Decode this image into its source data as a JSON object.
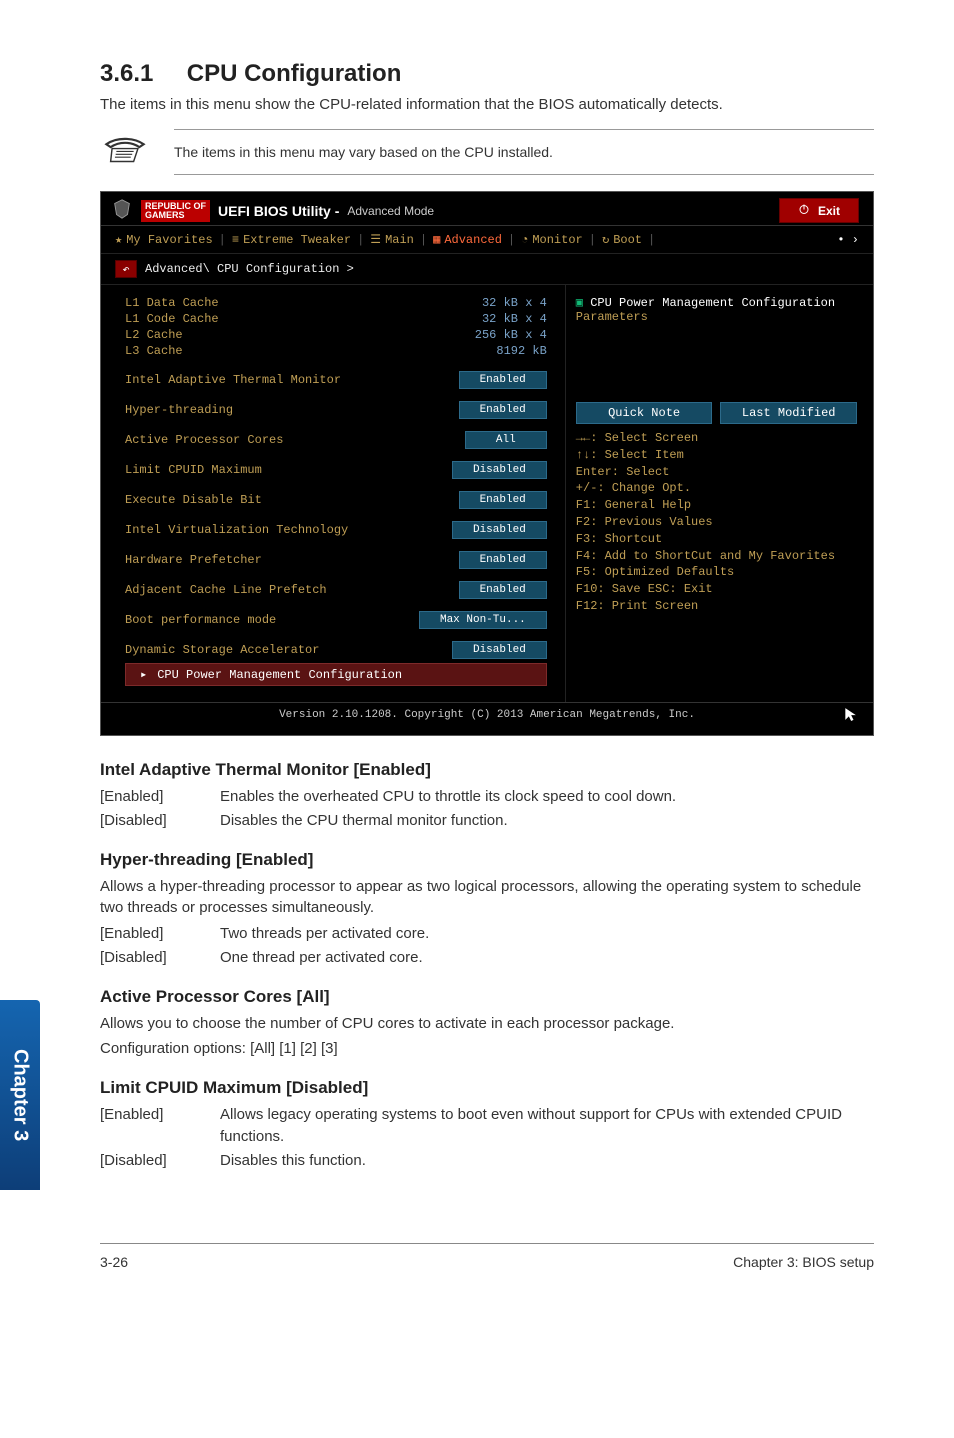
{
  "section": {
    "number": "3.6.1",
    "title": "CPU Configuration",
    "desc": "The items in this menu show the CPU-related information that the BIOS automatically detects.",
    "note": "The items in this menu may vary based on the CPU installed."
  },
  "bios": {
    "brand_top": "REPUBLIC OF",
    "brand_bottom": "GAMERS",
    "title_strong": "UEFI BIOS Utility -",
    "title_light": "Advanced Mode",
    "exit": "Exit",
    "tabs": {
      "fav": "My Favorites",
      "tweak": "Extreme Tweaker",
      "main": "Main",
      "adv": "Advanced",
      "monitor": "Monitor",
      "boot": "Boot"
    },
    "crumb": "Advanced\\ CPU Configuration >",
    "info": [
      {
        "k": "L1 Data Cache",
        "v": "32 kB x 4"
      },
      {
        "k": "L1 Code Cache",
        "v": "32 kB x 4"
      },
      {
        "k": "L2 Cache",
        "v": "256 kB x 4"
      },
      {
        "k": "L3 Cache",
        "v": "8192 kB"
      }
    ],
    "options": [
      {
        "label": "Intel Adaptive Thermal Monitor",
        "value": "Enabled"
      },
      {
        "label": "Hyper-threading",
        "value": "Enabled"
      },
      {
        "label": "Active Processor Cores",
        "value": "All"
      },
      {
        "label": "Limit CPUID Maximum",
        "value": "Disabled"
      },
      {
        "label": "Execute Disable Bit",
        "value": "Enabled"
      },
      {
        "label": "Intel Virtualization Technology",
        "value": "Disabled"
      },
      {
        "label": "Hardware Prefetcher",
        "value": "Enabled"
      },
      {
        "label": "Adjacent Cache Line Prefetch",
        "value": "Enabled"
      },
      {
        "label": "Boot performance mode",
        "value": "Max Non-Tu..."
      },
      {
        "label": "Dynamic Storage Accelerator",
        "value": "Disabled"
      }
    ],
    "selected_row": "CPU Power Management Configuration",
    "right_header": "CPU Power Management Configuration",
    "right_sub": "Parameters",
    "quick_note": "Quick Note",
    "last_modified": "Last Modified",
    "hints": [
      "→←: Select Screen",
      "↑↓: Select Item",
      "Enter: Select",
      "+/-: Change Opt.",
      "F1: General Help",
      "F2: Previous Values",
      "F3: Shortcut",
      "F4: Add to ShortCut and My Favorites",
      "F5: Optimized Defaults",
      "F10: Save  ESC: Exit",
      "F12: Print Screen"
    ],
    "footer": "Version 2.10.1208. Copyright (C) 2013 American Megatrends, Inc."
  },
  "settings": [
    {
      "head": "Intel Adaptive Thermal Monitor [Enabled]",
      "rows": [
        {
          "k": "[Enabled]",
          "d": "Enables the overheated CPU to throttle its clock speed to cool down."
        },
        {
          "k": "[Disabled]",
          "d": "Disables the CPU thermal monitor function."
        }
      ]
    },
    {
      "head": "Hyper-threading [Enabled]",
      "para": "Allows a hyper-threading processor to appear as two logical processors, allowing the operating system to schedule two threads or processes simultaneously.",
      "rows": [
        {
          "k": "[Enabled]",
          "d": "Two threads per activated core."
        },
        {
          "k": "[Disabled]",
          "d": "One thread per activated core."
        }
      ]
    },
    {
      "head": "Active Processor Cores [All]",
      "para": "Allows you to choose the number of CPU cores to activate in each processor package.",
      "para2": "Configuration options: [All] [1] [2] [3]"
    },
    {
      "head": "Limit CPUID Maximum [Disabled]",
      "rows": [
        {
          "k": "[Enabled]",
          "d": "Allows legacy operating systems to boot even without support for CPUs with extended CPUID functions."
        },
        {
          "k": "[Disabled]",
          "d": "Disables this function."
        }
      ]
    }
  ],
  "side_tab": "Chapter 3",
  "page_footer_left": "3-26",
  "page_footer_right": "Chapter 3: BIOS setup"
}
